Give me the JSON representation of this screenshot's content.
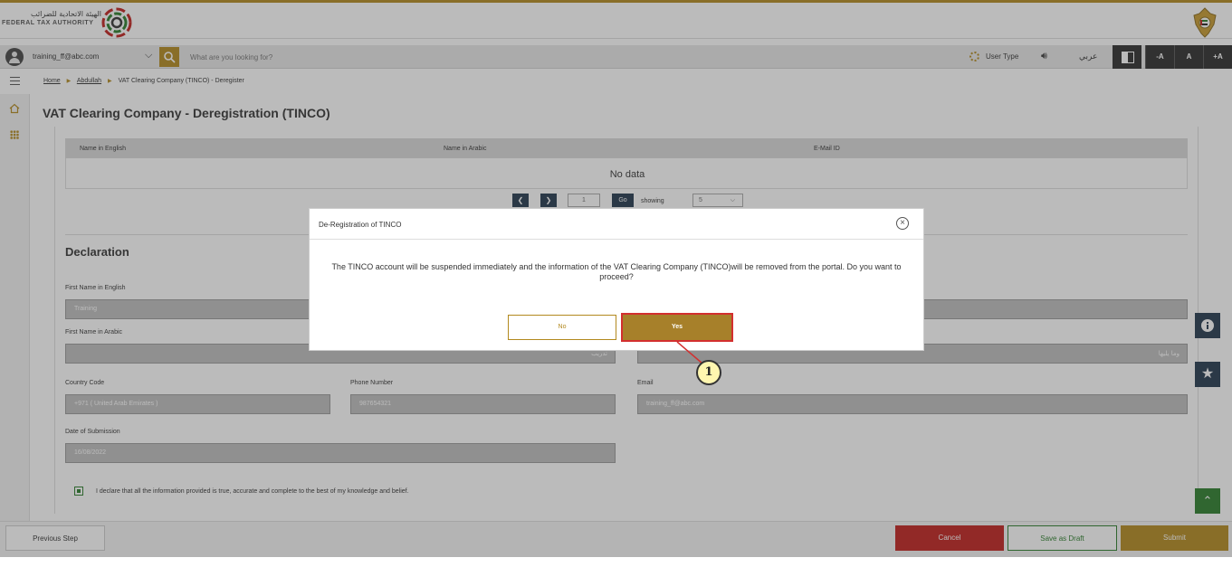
{
  "header": {
    "org_name_ar": "الهيئة الاتحادية للضرائب",
    "org_name_en": "FEDERAL TAX AUTHORITY"
  },
  "nav": {
    "username": "training_ff@abc.com",
    "search_placeholder": "What are you looking for?",
    "user_type_label": "User Type",
    "arabic_label": "عربي",
    "font_decrease": "-A",
    "font_normal": "A",
    "font_increase": "+A"
  },
  "breadcrumb": {
    "home": "Home",
    "level2": "Abdullah",
    "current": "VAT Clearing Company (TINCO) - Deregister"
  },
  "page": {
    "title": "VAT Clearing Company - Deregistration (TINCO)"
  },
  "grid": {
    "columns": [
      "Name in English",
      "Name in Arabic",
      "E-Mail ID"
    ],
    "empty_text": "No data",
    "page_value": "1",
    "go_label": "Go",
    "showing_label": "showing",
    "page_size": "5"
  },
  "declaration": {
    "section_title": "Declaration",
    "first_name_en_label": "First Name in English",
    "first_name_en_value": "Training",
    "first_name_ar_label": "First Name in Arabic",
    "first_name_ar_value": "تدريب",
    "last_name_ar_value": "وما يليها",
    "country_code_label": "Country Code",
    "country_code_value": "+971 ( United Arab Emirates )",
    "phone_label": "Phone Number",
    "phone_value": "987654321",
    "email_label": "Email",
    "email_value": "training_ff@abc.com",
    "date_label": "Date of Submission",
    "date_value": "16/08/2022",
    "declaration_text": "I declare that all the information provided is true, accurate and complete to the best of my knowledge and belief.",
    "checkbox_checked": true
  },
  "footer": {
    "previous_label": "Previous Step",
    "cancel_label": "Cancel",
    "draft_label": "Save as Draft",
    "submit_label": "Submit"
  },
  "modal": {
    "title": "De-Registration of TINCO",
    "message": "The TINCO account will be suspended immediately and the information of the VAT Clearing Company (TINCO)will be removed from the portal. Do you want to proceed?",
    "no_label": "No",
    "yes_label": "Yes"
  },
  "annotation": {
    "step_number": "1"
  },
  "colors": {
    "brand_gold": "#b2891e",
    "navy": "#22384d",
    "cancel_red": "#c0201c",
    "green": "#2a7d2a",
    "highlight_red": "#d32f2f"
  },
  "icons": [
    "user-icon",
    "search-icon",
    "gear-icon",
    "speaker-icon",
    "contrast-icon",
    "menu-icon",
    "home-icon",
    "grid-icon",
    "close-icon",
    "info-icon",
    "star-icon",
    "chevron-up-icon"
  ]
}
